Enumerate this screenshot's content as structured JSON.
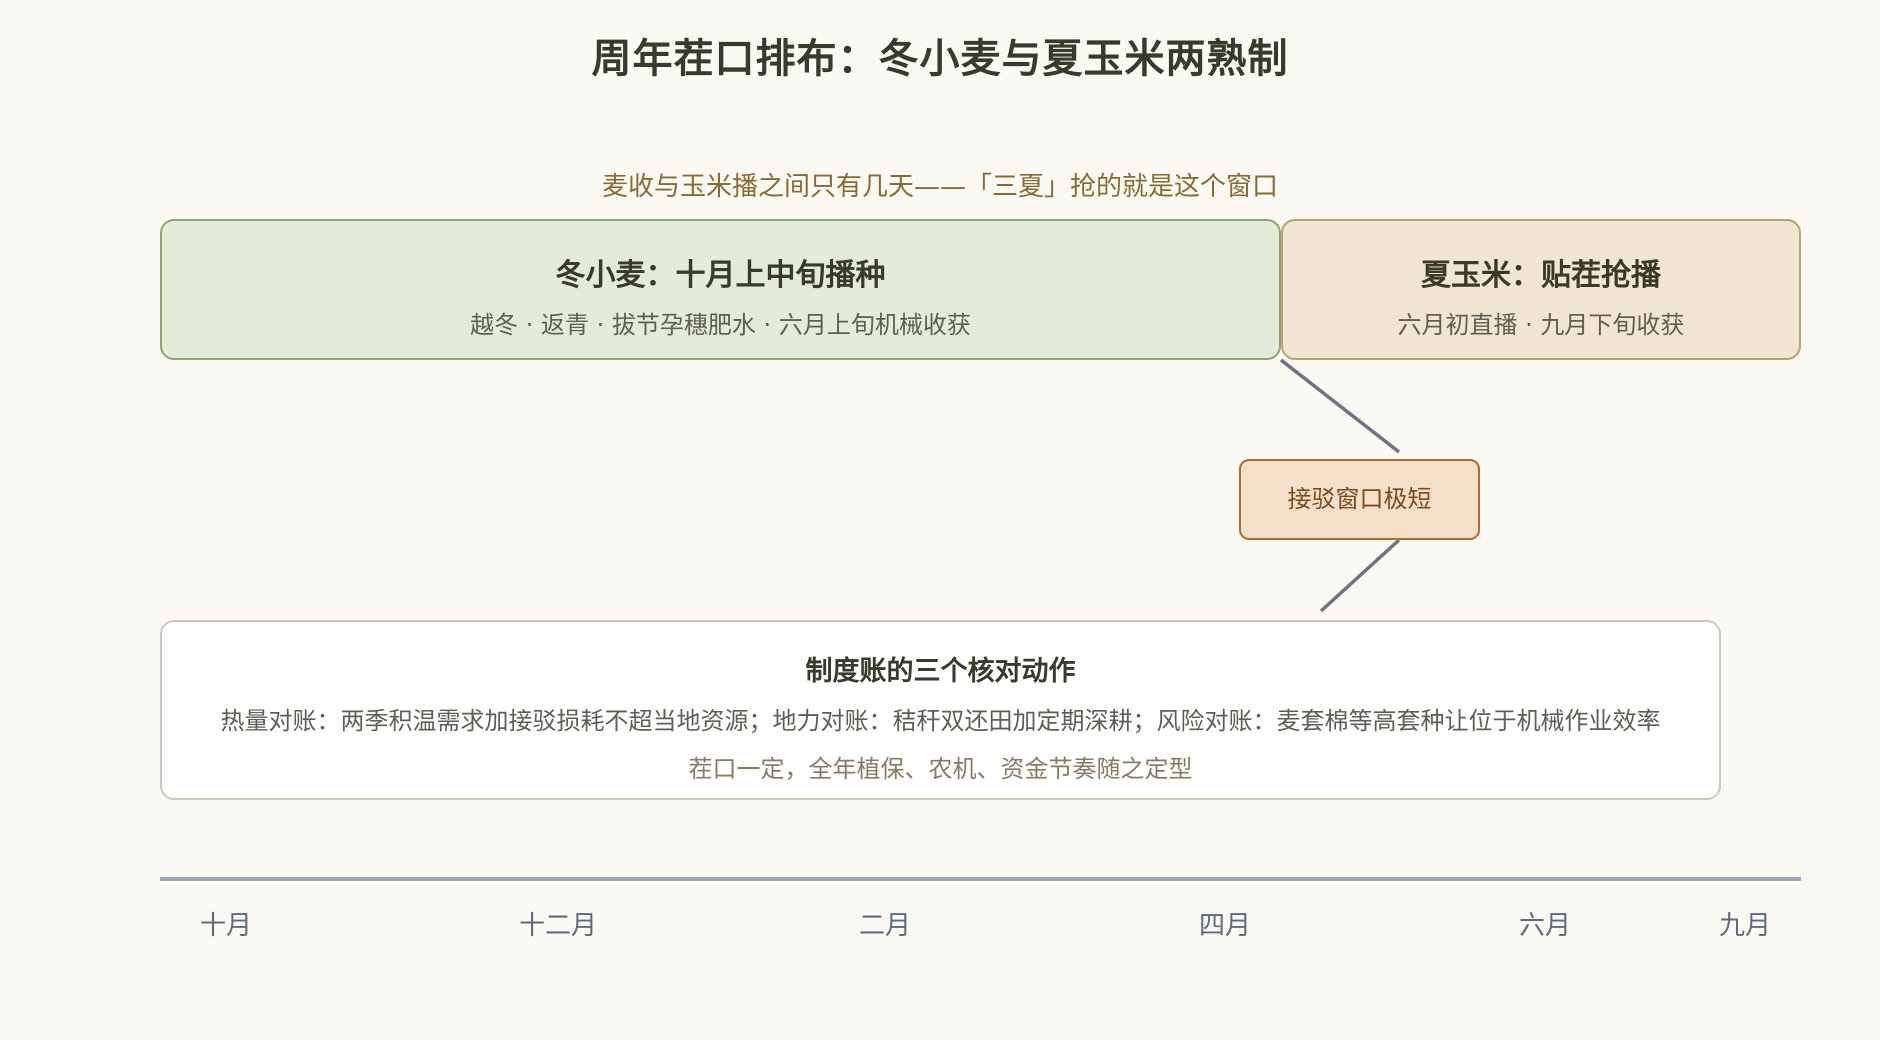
{
  "title": "周年茬口排布：冬小麦与夏玉米两熟制",
  "subtitle": "麦收与玉米播之间只有几天——「三夏」抢的就是这个窗口",
  "wheat": {
    "title": "冬小麦：十月上中旬播种",
    "desc": "越冬 · 返青 · 拔节孕穗肥水 · 六月上旬机械收获"
  },
  "corn": {
    "title": "夏玉米：贴茬抢播",
    "desc": "六月初直播 · 九月下旬收获"
  },
  "window": {
    "label": "接驳窗口极短"
  },
  "audit": {
    "title": "制度账的三个核对动作",
    "line1": "热量对账：两季积温需求加接驳损耗不超当地资源；地力对账：秸秆双还田加定期深耕；风险对账：麦套棉等高套种让位于机械作业效率",
    "line2": "茬口一定，全年植保、农机、资金节奏随之定型"
  },
  "timeline": {
    "ticks": [
      "十月",
      "十二月",
      "二月",
      "四月",
      "六月",
      "九月"
    ]
  },
  "colors": {
    "wheat_fill": "#e3ecd8",
    "corn_fill": "#f0e6d3",
    "window_fill": "#f5dfcb",
    "connector": "#6e7282",
    "axis": "#99a5b9"
  }
}
